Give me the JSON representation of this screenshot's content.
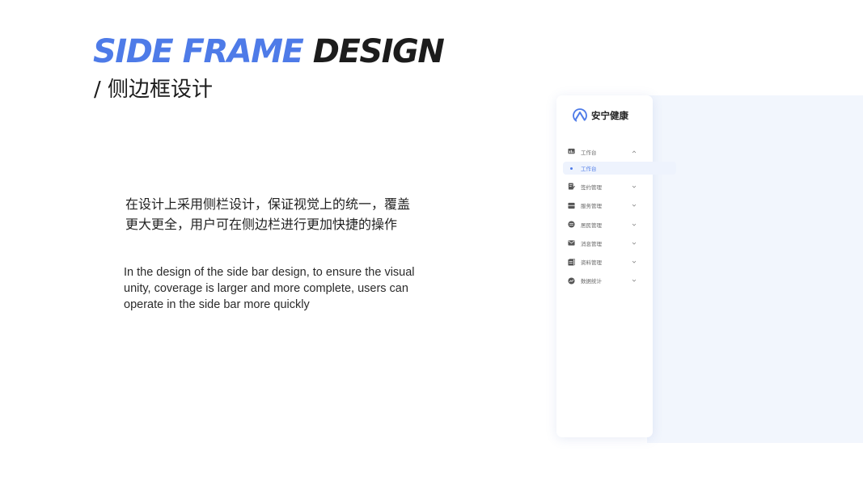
{
  "slide": {
    "title_accent": "SIDE FRAME",
    "title_rest": "DESIGN",
    "subtitle": "/  侧边框设计",
    "desc_cn": "在设计上采用侧栏设计，保证视觉上的统一，覆盖更大更全，用户可在侧边栏进行更加快捷的操作",
    "desc_en": "In the design of the side bar design, to ensure the visual unity, coverage is larger and more complete, users can operate in the side bar more quickly"
  },
  "colors": {
    "accent": "#4e7be8",
    "dark_text": "#1c1c1c",
    "content_bg": "#f2f6fd"
  },
  "sidebar": {
    "brand": "安宁健康",
    "brand_icon": "mountain-logo-icon",
    "items": [
      {
        "label": "工作台",
        "icon": "dashboard-icon",
        "expanded": true,
        "children": [
          {
            "label": "工作台",
            "active": true
          }
        ]
      },
      {
        "label": "签约管理",
        "icon": "contract-icon",
        "expanded": false
      },
      {
        "label": "服务管理",
        "icon": "service-icon",
        "expanded": false
      },
      {
        "label": "居民管理",
        "icon": "resident-icon",
        "expanded": false
      },
      {
        "label": "消息管理",
        "icon": "mail-icon",
        "expanded": false
      },
      {
        "label": "资料管理",
        "icon": "document-icon",
        "expanded": false
      },
      {
        "label": "数据统计",
        "icon": "chart-icon",
        "expanded": false
      }
    ]
  }
}
